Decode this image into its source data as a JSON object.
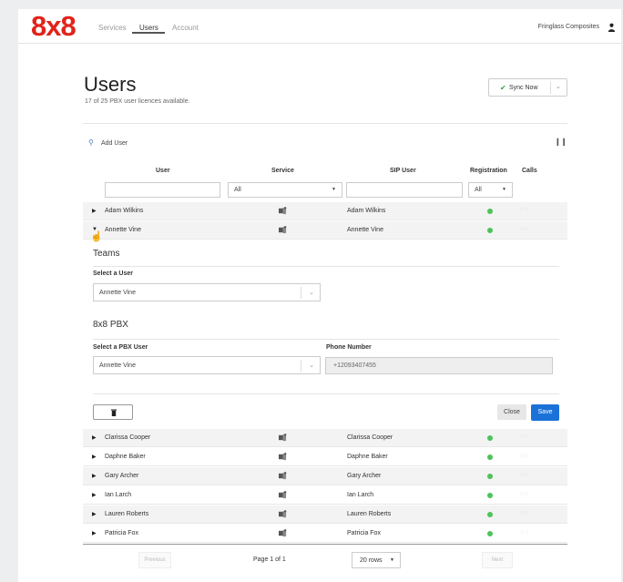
{
  "brand": {
    "logo": "8x8",
    "color": "#e2231a"
  },
  "nav": {
    "tabs": [
      "Services",
      "Users",
      "Account"
    ],
    "active": "Users",
    "company": "Fringlass Composites",
    "user_icon": "person-icon"
  },
  "page": {
    "title": "Users",
    "licences": "17 of 25 PBX user licences available.",
    "sync_label": "Sync Now"
  },
  "toolbar": {
    "add_user": "Add User",
    "columns_icon": "columns-icon"
  },
  "table": {
    "headers": {
      "user": "User",
      "service": "Service",
      "sip": "SIP User",
      "registration": "Registration",
      "calls": "Calls"
    },
    "filters": {
      "user": "",
      "service": "All",
      "sip": "",
      "registration": "All"
    },
    "rows_top": [
      {
        "name": "Adam Wilkins",
        "sip": "Adam Wilkins"
      },
      {
        "name": "Annette Vine",
        "sip": "Annette Vine"
      }
    ],
    "rows_bottom": [
      {
        "name": "Clarissa Cooper",
        "sip": "Clarissa Cooper"
      },
      {
        "name": "Daphne Baker",
        "sip": "Daphne Baker"
      },
      {
        "name": "Gary Archer",
        "sip": "Gary Archer"
      },
      {
        "name": "Ian Larch",
        "sip": "Ian Larch"
      },
      {
        "name": "Lauren Roberts",
        "sip": "Lauren Roberts"
      },
      {
        "name": "Patricia Fox",
        "sip": "Patricia Fox"
      }
    ],
    "status_color": "#4cc35a"
  },
  "detail": {
    "teams_title": "Teams",
    "select_user_label": "Select a User",
    "select_user_value": "Annette Vine",
    "pbx_title": "8x8 PBX",
    "select_pbx_label": "Select a PBX User",
    "select_pbx_value": "Annette Vine",
    "phone_label": "Phone Number",
    "phone_value": "+12093407455",
    "close_label": "Close",
    "save_label": "Save",
    "save_color": "#1a72d9"
  },
  "pagination": {
    "previous": "Previous",
    "page": "Page 1 of 1",
    "rows": "20 rows",
    "next": "Next"
  }
}
